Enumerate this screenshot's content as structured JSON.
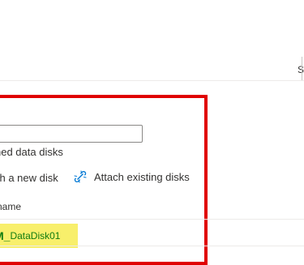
{
  "table_header": {
    "column_label": "St"
  },
  "data_disks_panel": {
    "name_input_value": "",
    "hint_text": "ned data disks",
    "create_new_disk_label": "ch a new disk",
    "attach_existing_label": "Attach existing disks",
    "name_column_header": "name",
    "rows": [
      {
        "name_prefix": "M_",
        "name_suffix": "DataDisk01"
      }
    ]
  },
  "colors": {
    "highlight_border": "#e00000",
    "row_highlight": "#f8ef6b",
    "disk_name_text": "#107c10",
    "attach_icon": "#0078d4"
  },
  "icons": {
    "attach_existing": "link-icon"
  }
}
